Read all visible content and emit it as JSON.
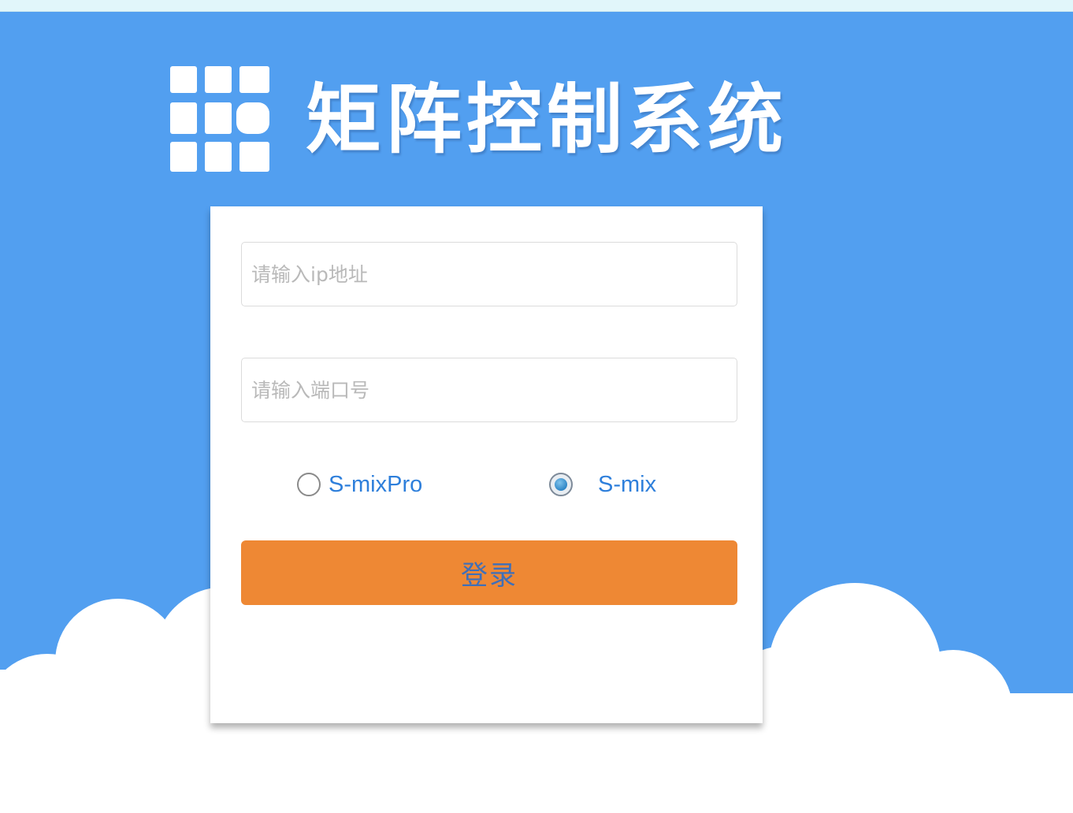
{
  "brand": {
    "title": "矩阵控制系统",
    "logo_icon": "grid-logo-icon"
  },
  "colors": {
    "sky": "#529ff0",
    "top_strip": "#e1f6fa",
    "button": "#ee8834",
    "button_text": "#3f6fb8",
    "radio_label": "#2e7fdb"
  },
  "form": {
    "ip_input": {
      "placeholder": "请输入ip地址",
      "value": ""
    },
    "port_input": {
      "placeholder": "请输入端口号",
      "value": ""
    },
    "device_options": [
      {
        "label": "S-mixPro",
        "selected": false
      },
      {
        "label": "S-mix",
        "selected": true
      }
    ],
    "login_label": "登录"
  }
}
